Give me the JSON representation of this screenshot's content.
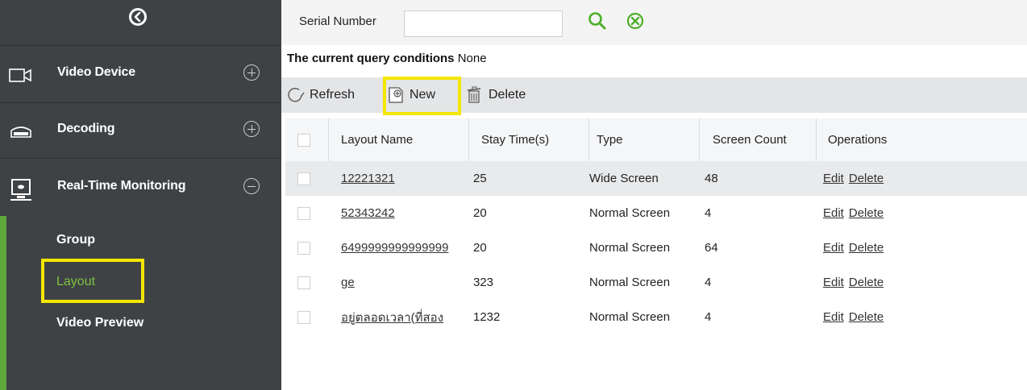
{
  "sidebar": {
    "items": [
      {
        "label": "Video Device",
        "icon": "camera-icon",
        "expanded": false
      },
      {
        "label": "Decoding",
        "icon": "decoder-icon",
        "expanded": false
      },
      {
        "label": "Real-Time Monitoring",
        "icon": "monitor-icon",
        "expanded": true
      }
    ],
    "submenu": [
      "Group",
      "Layout",
      "Video Preview"
    ],
    "active_submenu": "Layout"
  },
  "search": {
    "label": "Serial Number",
    "value": ""
  },
  "query": {
    "label": "The current query conditions",
    "value": "None"
  },
  "toolbar": {
    "refresh_label": "Refresh",
    "new_label": "New",
    "delete_label": "Delete"
  },
  "table": {
    "columns": [
      "Layout Name",
      "Stay Time(s)",
      "Type",
      "Screen Count",
      "Operations"
    ],
    "rows": [
      {
        "name": "12221321",
        "stay": "25",
        "type": "Wide Screen",
        "count": "48"
      },
      {
        "name": "52343242",
        "stay": "20",
        "type": "Normal Screen",
        "count": "4"
      },
      {
        "name": "6499999999999999",
        "stay": "20",
        "type": "Normal Screen",
        "count": "64"
      },
      {
        "name": "ge",
        "stay": "323",
        "type": "Normal Screen",
        "count": "4"
      },
      {
        "name": "อยู่ตลอดเวลา(ที่สอง",
        "stay": "1232",
        "type": "Normal Screen",
        "count": "4"
      }
    ],
    "edit_label": "Edit",
    "delete_label": "Delete"
  },
  "colors": {
    "sidebar_bg": "#3f4245",
    "accent_green": "#7bc242",
    "highlight_yellow": "#f3e600",
    "search_icon_green": "#4caf28"
  }
}
